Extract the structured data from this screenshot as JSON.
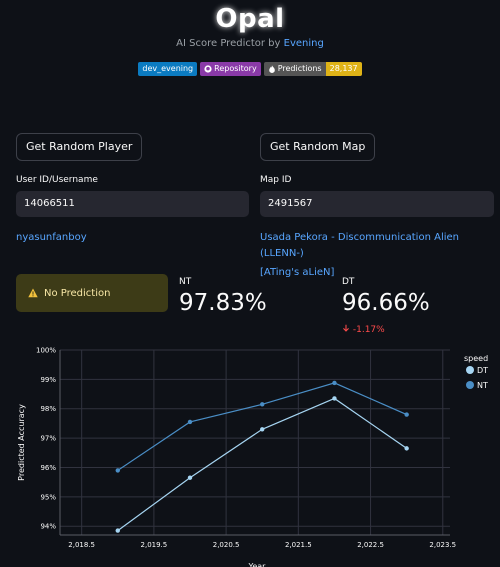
{
  "header": {
    "title": "Opal",
    "subtitle_prefix": "AI Score Predictor by ",
    "subtitle_link": "Evening"
  },
  "badges": {
    "author": "dev_evening",
    "repo": "Repository",
    "predictions_label": "Predictions",
    "predictions_count": "28,137"
  },
  "buttons": {
    "random_player": "Get Random Player",
    "random_map": "Get Random Map"
  },
  "fields": {
    "user_label": "User ID/Username",
    "user_value": "14066511",
    "map_label": "Map ID",
    "map_value": "2491567"
  },
  "links": {
    "player_name": "nyasunfanboy",
    "map_line1": "Usada Pekora - Discommunication Alien (LLENN-)",
    "map_line2": "[ATing's aLieN]"
  },
  "alert": {
    "text": "No Prediction"
  },
  "metrics": {
    "nt_label": "NT",
    "nt_value": "97.83%",
    "dt_label": "DT",
    "dt_value": "96.66%",
    "dt_delta": "-1.17%"
  },
  "colors": {
    "dt": "#a6d5f2",
    "nt": "#4a8ec6",
    "delta_negative": "#ff4b4b"
  },
  "chart_data": {
    "type": "line",
    "ylabel": "Predicted Accuracy",
    "xlabel": "Year",
    "x_ticks": [
      "2,018.5",
      "2,019.5",
      "2,020.5",
      "2,021.5",
      "2,022.5",
      "2,023.5"
    ],
    "y_ticks": [
      "94%",
      "95%",
      "96%",
      "97%",
      "98%",
      "99%",
      "100%"
    ],
    "xlim": [
      2018.2,
      2023.6
    ],
    "ylim": [
      93.7,
      100
    ],
    "legend_title": "speed",
    "legend_position": "right",
    "series": [
      {
        "name": "DT",
        "x": [
          2019,
          2020,
          2021,
          2022,
          2023
        ],
        "values": [
          93.85,
          95.65,
          97.3,
          98.35,
          96.65
        ]
      },
      {
        "name": "NT",
        "x": [
          2019,
          2020,
          2021,
          2022,
          2023
        ],
        "values": [
          95.9,
          97.55,
          98.15,
          98.88,
          97.8
        ]
      }
    ]
  }
}
